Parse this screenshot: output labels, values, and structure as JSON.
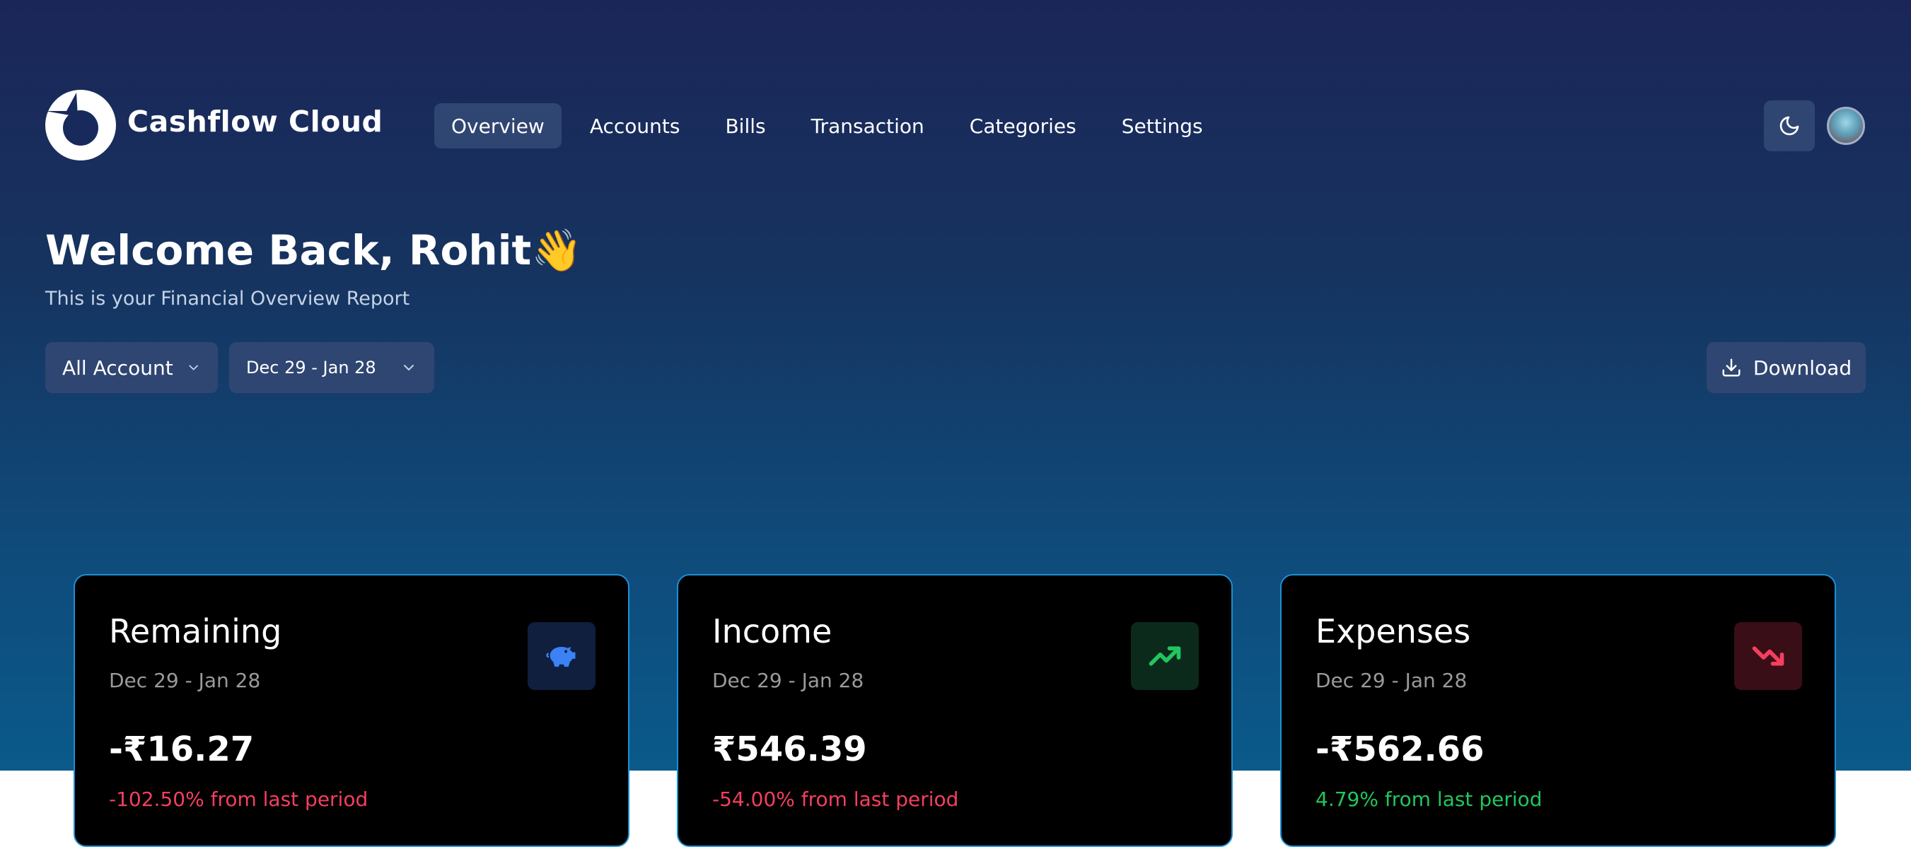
{
  "app": {
    "name": "Cashflow Cloud"
  },
  "nav": {
    "items": [
      {
        "label": "Overview",
        "active": true
      },
      {
        "label": "Accounts",
        "active": false
      },
      {
        "label": "Bills",
        "active": false
      },
      {
        "label": "Transaction",
        "active": false
      },
      {
        "label": "Categories",
        "active": false
      },
      {
        "label": "Settings",
        "active": false
      }
    ]
  },
  "header": {
    "theme_icon": "moon-icon",
    "avatar": "user-avatar"
  },
  "welcome": {
    "title": "Welcome Back, Rohit👋",
    "subtitle": "This is your Financial Overview Report"
  },
  "filters": {
    "account": "All Account",
    "date_range": "Dec 29 - Jan 28",
    "download_label": "Download"
  },
  "cards": [
    {
      "title": "Remaining",
      "range": "Dec 29 - Jan 28",
      "amount": "-₹16.27",
      "change": "-102.50% from last period",
      "change_color": "#f43f5e",
      "icon": "piggy-bank-icon",
      "icon_bg": "#0f1f3d",
      "icon_color": "#3b82f6"
    },
    {
      "title": "Income",
      "range": "Dec 29 - Jan 28",
      "amount": "₹546.39",
      "change": "-54.00% from last period",
      "change_color": "#f43f5e",
      "icon": "trending-up-icon",
      "icon_bg": "#0b2a1c",
      "icon_color": "#22c55e"
    },
    {
      "title": "Expenses",
      "range": "Dec 29 - Jan 28",
      "amount": "-₹562.66",
      "change": "4.79% from last period",
      "change_color": "#22c55e",
      "icon": "trending-down-icon",
      "icon_bg": "#3a0e17",
      "icon_color": "#f43f5e"
    }
  ],
  "colors": {
    "hero_top": "#1b2658",
    "hero_bottom": "#0a5a8a",
    "button_bg": "#2f4672",
    "card_border": "#1e8fd6"
  }
}
